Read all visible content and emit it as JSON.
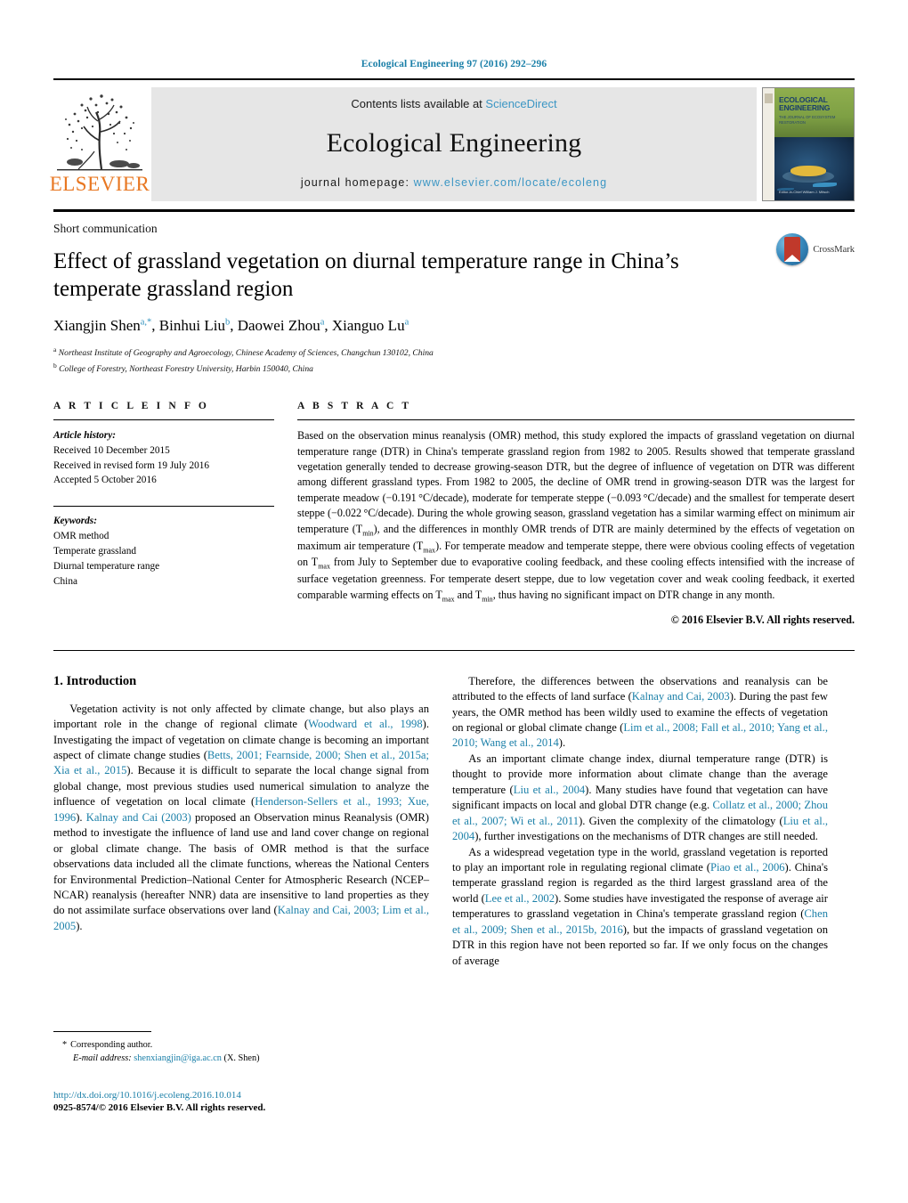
{
  "running_head": "Ecological Engineering 97 (2016) 292–296",
  "masthead": {
    "contents_prefix": "Contents lists available at ",
    "sciencedirect": "ScienceDirect",
    "journal_name": "Ecological Engineering",
    "homepage_prefix": "journal homepage: ",
    "homepage_url": "www.elsevier.com/locate/ecoleng",
    "publisher": "ELSEVIER",
    "cover_title_line1": "ECOLOGICAL",
    "cover_title_line2": "ENGINEERING",
    "cover_subtitle": "THE JOURNAL OF\nECOSYSTEM RESTORATION",
    "cover_footer": "Editor-in-Chief\nWilliam J. Mitsch",
    "accent_blue": "#1a7fa8",
    "elsevier_orange": "#E87722"
  },
  "article": {
    "type": "Short communication",
    "title": "Effect of grassland vegetation on diurnal temperature range in China’s temperate grassland region",
    "authors_html": "Xiangjin Shen<sup>a,<span class=\"star\">*</span></sup>, Binhui Liu<sup>b</sup>, Daowei Zhou<sup>a</sup>, Xianguo Lu<sup>a</sup>",
    "affiliations": [
      {
        "marker": "a",
        "text": "Northeast Institute of Geography and Agroecology, Chinese Academy of Sciences, Changchun 130102, China"
      },
      {
        "marker": "b",
        "text": "College of Forestry, Northeast Forestry University, Harbin 150040, China"
      }
    ],
    "crossmark_label": "CrossMark"
  },
  "info": {
    "heading": "A R T I C L E    I N F O",
    "history_label": "Article history:",
    "history": [
      "Received 10 December 2015",
      "Received in revised form 19 July 2016",
      "Accepted 5 October 2016"
    ],
    "keywords_label": "Keywords:",
    "keywords": [
      "OMR method",
      "Temperate grassland",
      "Diurnal temperature range",
      "China"
    ]
  },
  "abstract": {
    "heading": "A B S T R A C T",
    "text_html": "Based on the observation minus reanalysis (OMR) method, this study explored the impacts of grassland vegetation on diurnal temperature range (DTR) in China's temperate grassland region from 1982 to 2005. Results showed that temperate grassland vegetation generally tended to decrease growing-season DTR, but the degree of influence of vegetation on DTR was different among different grassland types. From 1982 to 2005, the decline of OMR trend in growing-season DTR was the largest for temperate meadow (&minus;0.191&#8201;&deg;C/decade), moderate for temperate steppe (&minus;0.093&#8201;&deg;C/decade) and the smallest for temperate desert steppe (&minus;0.022&#8201;&deg;C/decade). During the whole growing season, grassland vegetation has a similar warming effect on minimum air temperature (T<sub>min</sub>), and the differences in monthly OMR trends of DTR are mainly determined by the effects of vegetation on maximum air temperature (T<sub>max</sub>). For temperate meadow and temperate steppe, there were obvious cooling effects of vegetation on T<sub>max</sub> from July to September due to evaporative cooling feedback, and these cooling effects intensified with the increase of surface vegetation greenness. For temperate desert steppe, due to low vegetation cover and weak cooling feedback, it exerted comparable warming effects on T<sub>max</sub> and T<sub>min</sub>, thus having no significant impact on DTR change in any month.",
    "copyright": "© 2016 Elsevier B.V. All rights reserved."
  },
  "body": {
    "section_heading": "1.  Introduction",
    "left_paragraphs_html": [
      "Vegetation activity is not only affected by climate change, but also plays an important role in the change of regional climate (<span class=\"ref\">Woodward et al., 1998</span>). Investigating the impact of vegetation on climate change is becoming an important aspect of climate change studies (<span class=\"ref\">Betts, 2001; Fearnside, 2000; Shen et al., 2015a; Xia et al., 2015</span>). Because it is difficult to separate the local change signal from global change, most previous studies used numerical simulation to analyze the influence of vegetation on local climate (<span class=\"ref\">Henderson-Sellers et al., 1993; Xue, 1996</span>). <span class=\"ref\">Kalnay and Cai (2003)</span> proposed an Observation minus Reanalysis (OMR) method to investigate the influence of land use and land cover change on regional or global climate change. The basis of OMR method is that the surface observations data included all the climate functions, whereas the National Centers for Environmental Prediction–National Center for Atmospheric Research (NCEP–NCAR) reanalysis (hereafter NNR) data are insensitive to land properties as they do not assimilate surface observations over land (<span class=\"ref\">Kalnay and Cai, 2003; Lim et al., 2005</span>)."
    ],
    "right_paragraphs_html": [
      "Therefore, the differences between the observations and reanalysis can be attributed to the effects of land surface (<span class=\"ref\">Kalnay and Cai, 2003</span>). During the past few years, the OMR method has been wildly used to examine the effects of vegetation on regional or global climate change (<span class=\"ref\">Lim et al., 2008; Fall et al., 2010; Yang et al., 2010; Wang et al., 2014</span>).",
      "As an important climate change index, diurnal temperature range (DTR) is thought to provide more information about climate change than the average temperature (<span class=\"ref\">Liu et al., 2004</span>). Many studies have found that vegetation can have significant impacts on local and global DTR change (e.g. <span class=\"ref\">Collatz et al., 2000; Zhou et al., 2007; Wi et al., 2011</span>). Given the complexity of the climatology (<span class=\"ref\">Liu et al., 2004</span>), further investigations on the mechanisms of DTR changes are still needed.",
      "As a widespread vegetation type in the world, grassland vegetation is reported to play an important role in regulating regional climate (<span class=\"ref\">Piao et al., 2006</span>). China's temperate grassland region is regarded as the third largest grassland area of the world (<span class=\"ref\">Lee et al., 2002</span>). Some studies have investigated the response of average air temperatures to grassland vegetation in China's temperate grassland region (<span class=\"ref\">Chen et al., 2009; Shen et al., 2015b, 2016</span>), but the impacts of grassland vegetation on DTR in this region have not been reported so far. If we only focus on the changes of average"
    ]
  },
  "footnotes": {
    "corresponding_marker": "*",
    "corresponding_text": "Corresponding author.",
    "email_label": "E-mail address:",
    "email": "shenxiangjin@iga.ac.cn",
    "email_suffix": "(X. Shen)"
  },
  "footer": {
    "doi": "http://dx.doi.org/10.1016/j.ecoleng.2016.10.014",
    "issn_line": "0925-8574/© 2016 Elsevier B.V. All rights reserved."
  }
}
